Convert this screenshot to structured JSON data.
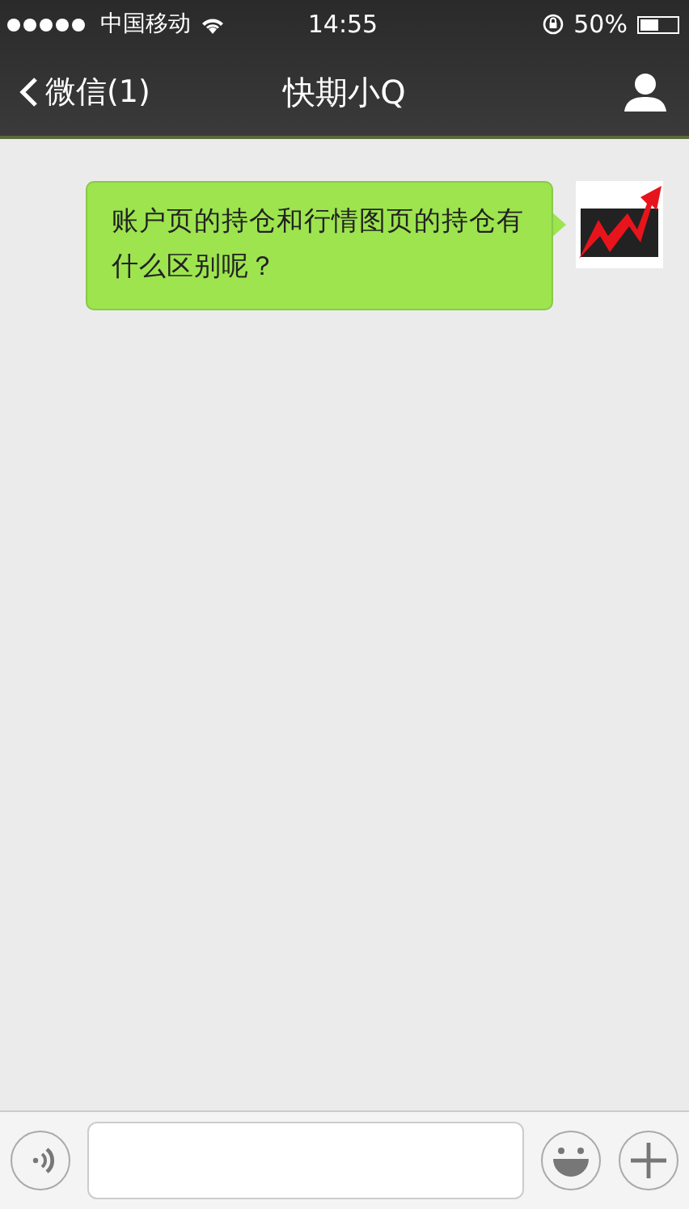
{
  "status_bar": {
    "carrier": "中国移动",
    "time": "14:55",
    "battery": "50%"
  },
  "nav": {
    "back": "微信(1)",
    "title": "快期小Q"
  },
  "messages": [
    {
      "kind": "outgoing",
      "text": "账户页的持仓和行情图页的持仓有什么区别呢？"
    }
  ]
}
